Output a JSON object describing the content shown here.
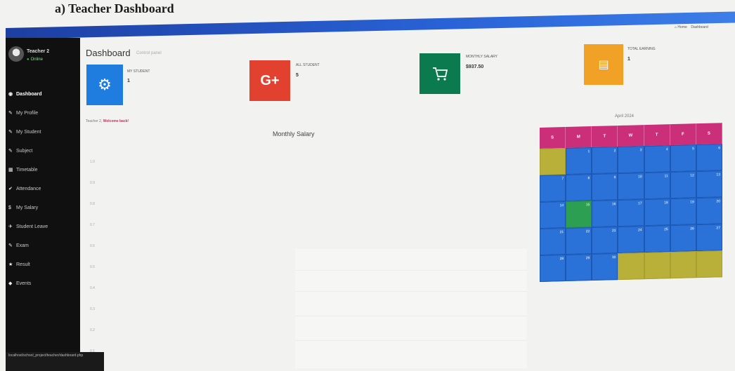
{
  "caption": "a) Teacher Dashboard",
  "breadcrumb": {
    "home": "Home",
    "current": "Dashboard"
  },
  "sidebar": {
    "user_name": "Teacher 2",
    "user_status": "Online",
    "items": [
      {
        "label": "Dashboard",
        "icon": "dashboard-icon"
      },
      {
        "label": "My Profile",
        "icon": "user-icon"
      },
      {
        "label": "My Student",
        "icon": "users-icon"
      },
      {
        "label": "Subject",
        "icon": "book-icon"
      },
      {
        "label": "Timetable",
        "icon": "calendar-icon"
      },
      {
        "label": "Attendance",
        "icon": "check-icon"
      },
      {
        "label": "My Salary",
        "icon": "money-icon"
      },
      {
        "label": "Student Leave",
        "icon": "leave-icon"
      },
      {
        "label": "Exam",
        "icon": "exam-icon"
      },
      {
        "label": "Result",
        "icon": "result-icon"
      },
      {
        "label": "Events",
        "icon": "event-icon"
      }
    ],
    "status_url": "localhost/school_project/teacher/dashboard.php"
  },
  "page": {
    "title": "Dashboard",
    "subtitle": "Control panel"
  },
  "tiles": [
    {
      "label": "My Student",
      "value": "1",
      "icon": "gear-icon",
      "color": "#1f7de0"
    },
    {
      "label": "All Student",
      "value": "5",
      "icon": "google-plus-icon",
      "color": "#e3412f"
    },
    {
      "label": "Monthly Salary",
      "value": "$937.50",
      "icon": "cart-icon",
      "color": "#0b7a4e"
    },
    {
      "label": "Total Earning",
      "value": "1",
      "icon": "money-icon",
      "color": "#f1a125"
    }
  ],
  "welcome": {
    "prefix": "Teacher 2,",
    "highlight": "Welcome back!"
  },
  "chart": {
    "title": "Monthly Salary",
    "yticks": [
      "1.0",
      "0.9",
      "0.8",
      "0.7",
      "0.6",
      "0.5",
      "0.4",
      "0.3",
      "0.2",
      "0.1"
    ]
  },
  "calendar": {
    "title": "April 2024",
    "weekdays": [
      "S",
      "M",
      "T",
      "W",
      "T",
      "F",
      "S"
    ],
    "cells": [
      "",
      "1",
      "2",
      "3",
      "4",
      "5",
      "6",
      "7",
      "8",
      "9",
      "10",
      "11",
      "12",
      "13",
      "14",
      "15",
      "16",
      "17",
      "18",
      "19",
      "20",
      "21",
      "22",
      "23",
      "24",
      "25",
      "26",
      "27",
      "28",
      "29",
      "30",
      "",
      "",
      "",
      ""
    ]
  },
  "colors": {
    "topbar": "#2962d6",
    "sidebar": "#101010",
    "calendar_header": "#cc2f79",
    "calendar_cell": "#2a72d8",
    "calendar_off": "#b9b03a",
    "calendar_event": "#2c9f53"
  }
}
